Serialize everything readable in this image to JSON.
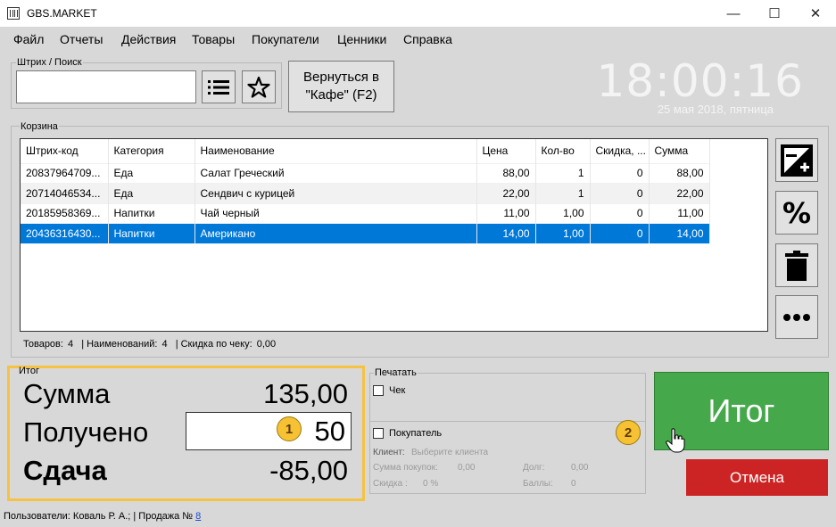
{
  "window": {
    "title": "GBS.MARKET",
    "controls": {
      "minimize": "—",
      "maximize": "☐",
      "close": "✕"
    }
  },
  "menu": [
    "Файл",
    "Отчеты",
    "Действия",
    "Товары",
    "Покупатели",
    "Ценники",
    "Справка"
  ],
  "search": {
    "group_label": "Штрих / Поиск",
    "value": "",
    "list_icon": "list-icon",
    "favorites_icon": "star-icon"
  },
  "return_button": {
    "line1": "Вернуться в",
    "line2": "\"Кафе\" (F2)"
  },
  "clock": {
    "time": "18:00:16",
    "date": "25 мая 2018, пятница"
  },
  "cart": {
    "group_label": "Корзина",
    "columns": [
      "Штрих-код",
      "Категория",
      "Наименование",
      "Цена",
      "Кол-во",
      "Скидка, ...",
      "Сумма"
    ],
    "rows": [
      {
        "barcode": "20837964709...",
        "category": "Еда",
        "name": "Салат Греческий",
        "price": "88,00",
        "qty": "1",
        "discount": "0",
        "sum": "88,00"
      },
      {
        "barcode": "20714046534...",
        "category": "Еда",
        "name": "Сендвич с курицей",
        "price": "22,00",
        "qty": "1",
        "discount": "0",
        "sum": "22,00"
      },
      {
        "barcode": "20185958369...",
        "category": "Напитки",
        "name": "Чай черный",
        "price": "11,00",
        "qty": "1,00",
        "discount": "0",
        "sum": "11,00"
      },
      {
        "barcode": "20436316430...",
        "category": "Напитки",
        "name": "Американо",
        "price": "14,00",
        "qty": "1,00",
        "discount": "0",
        "sum": "14,00"
      }
    ],
    "selected_row": 3,
    "side_buttons": [
      "edit-add-icon",
      "percent-icon",
      "trash-icon",
      "more-icon"
    ]
  },
  "summary": {
    "goods_label": "Товаров:",
    "goods_value": "4",
    "names_label": "| Наименований:",
    "names_value": "4",
    "discount_label": "| Скидка по чеку:",
    "discount_value": "0,00"
  },
  "itog": {
    "group_label": "Итог",
    "sum_label": "Сумма",
    "sum_value": "135,00",
    "received_label": "Получено",
    "received_value": "50",
    "change_label": "Сдача",
    "change_value": "-85,00",
    "badge1": "1"
  },
  "print": {
    "group_label": "Печатать",
    "receipt_label": "Чек",
    "customer_label": "Покупатель",
    "client_label": "Клиент:",
    "client_placeholder": "Выберите клиента",
    "purchases_label": "Сумма покупок:",
    "purchases_value": "0,00",
    "debt_label": "Долг:",
    "debt_value": "0,00",
    "discount_label": "Скидка :",
    "discount_value": "0 %",
    "points_label": "Баллы:",
    "points_value": "0",
    "badge2": "2"
  },
  "buttons": {
    "itog": "Итог",
    "cancel": "Отмена"
  },
  "status": {
    "users_label": "Пользователи:",
    "users_value": "Коваль Р. А.;",
    "sale_label": "| Продажа №",
    "sale_value": "8"
  },
  "colors": {
    "accent_green": "#45a84a",
    "cancel_red": "#cc2424",
    "selection_blue": "#0078d7",
    "highlight_yellow": "#f5c242"
  }
}
